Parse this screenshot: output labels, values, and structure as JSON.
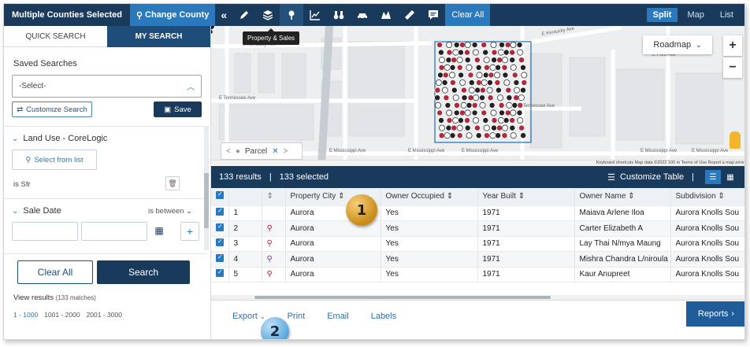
{
  "topbar": {
    "selection_label": "Multiple Counties Selected",
    "change_county_label": "Change County",
    "collapse_glyph": "«",
    "clear_all_label": "Clear All",
    "tooltip": "Property & Sales",
    "view_modes": [
      "Split",
      "Map",
      "List"
    ],
    "active_view": "Split",
    "tools": [
      "pencil-icon",
      "layers-icon",
      "pin-icon",
      "chart-icon",
      "binoculars-icon",
      "car-icon",
      "map-area-icon",
      "ruler-icon",
      "comment-icon"
    ]
  },
  "left_panel": {
    "tabs": [
      "QUICK SEARCH",
      "MY SEARCH"
    ],
    "active_tab": "MY SEARCH",
    "saved_searches_title": "Saved Searches",
    "saved_search_select": "-Select-",
    "customize_search_label": "Customize Search",
    "save_label": "Save",
    "land_use_title": "Land Use - CoreLogic",
    "select_from_list_label": "Select from list",
    "land_use_value": "is Sfr",
    "sale_date_title": "Sale Date",
    "sale_date_operator": "is between",
    "clear_all_label": "Clear All",
    "search_label": "Search",
    "view_results_label": "View results",
    "view_results_count": "(133 matches)",
    "pages": [
      "1 - 1000",
      "1001 - 2000",
      "2001 - 3000"
    ]
  },
  "map": {
    "roadmap_label": "Roadmap",
    "zoom_in": "+",
    "zoom_out": "−",
    "parcel_label": "Parcel",
    "streets": [
      "E Kentucky Ave",
      "E Kentucky Ave",
      "E Tennessee Ave",
      "E Tennessee Ave",
      "E Mississippi Ave",
      "E Mississippi Ave",
      "E Mississippi Ave",
      "E Mississippi Ave",
      "E Mississippi Ave",
      "E Ford Ave"
    ],
    "attribution": "Keyboard shortcuts   Map data ©2022   100 m   Terms of Use   Report a map error"
  },
  "results": {
    "count_label": "133 results",
    "selected_label": "133 selected",
    "customize_table_label": "Customize Table",
    "columns": [
      "Property City",
      "Owner Occupied",
      "Year Built",
      "Owner Name",
      "Subdivision"
    ],
    "rows": [
      {
        "n": "1",
        "pin": "",
        "city": "Aurora",
        "occupied": "Yes",
        "year": "1971",
        "owner": "Maiava Arlene Iloa",
        "subdivision": "Aurora Knolls Sou"
      },
      {
        "n": "2",
        "pin": "red",
        "city": "Aurora",
        "occupied": "Yes",
        "year": "1971",
        "owner": "Carter Elizabeth A",
        "subdivision": "Aurora Knolls Sou"
      },
      {
        "n": "3",
        "pin": "red",
        "city": "Aurora",
        "occupied": "Yes",
        "year": "1971",
        "owner": "Lay Thai N/mya Maung",
        "subdivision": "Aurora Knolls Sou"
      },
      {
        "n": "4",
        "pin": "purple",
        "city": "Aurora",
        "occupied": "Yes",
        "year": "1971",
        "owner": "Mishra Chandra L/niroula",
        "subdivision": "Aurora Knolls Sou"
      },
      {
        "n": "5",
        "pin": "red",
        "city": "Aurora",
        "occupied": "Yes",
        "year": "1971",
        "owner": "Kaur Anupreet",
        "subdivision": "Aurora Knolls Sou"
      }
    ]
  },
  "bottom": {
    "links": [
      "Export",
      "Print",
      "Email",
      "Labels"
    ],
    "reports_label": "Reports"
  },
  "callouts": [
    "1",
    "2"
  ],
  "colors": {
    "navy": "#1a3a5c",
    "accent": "#2a79bd",
    "pin_red": "#b1293a",
    "pin_purple": "#6e3d9a",
    "callout_gold": "#c98a16",
    "callout_blue": "#5aa6dc"
  }
}
